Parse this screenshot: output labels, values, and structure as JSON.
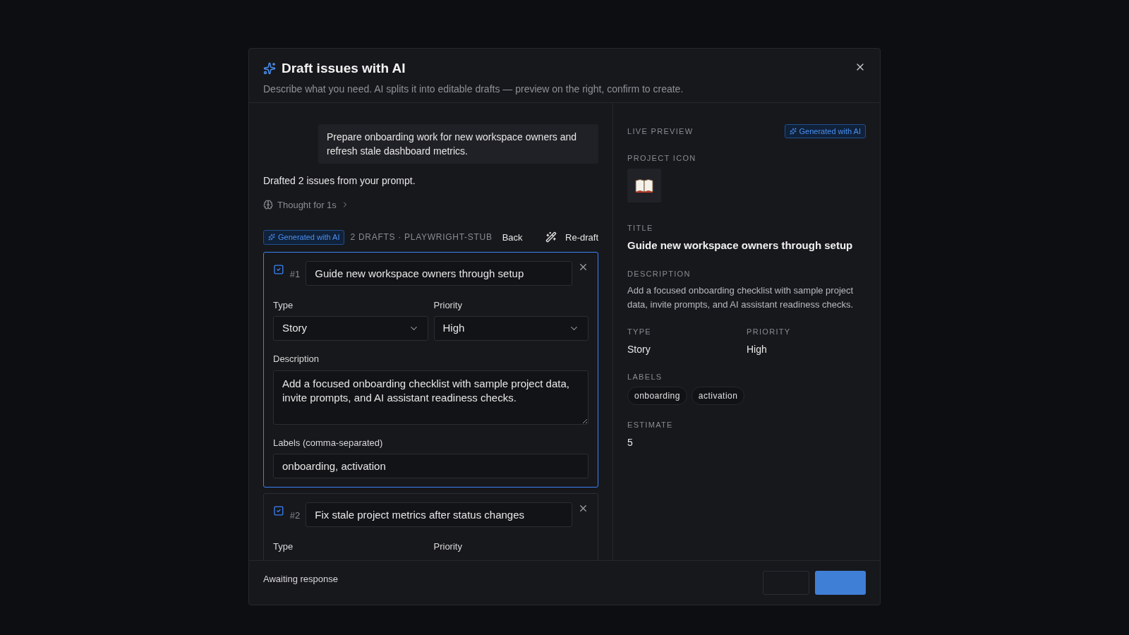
{
  "dialog": {
    "title": "Draft issues with AI",
    "subtitle": "Describe what you need. AI splits it into editable drafts — preview on the right, confirm to create."
  },
  "prompt": "Prepare onboarding work for new workspace owners and refresh stale dashboard metrics.",
  "response": "Drafted 2 issues from your prompt.",
  "thought": {
    "label": "Thought for 1s",
    "expanded": false
  },
  "toolbar": {
    "badge": "Generated with AI",
    "meta": "2 DRAFTS · PLAYWRIGHT-STUB",
    "back": "Back",
    "redraft": "Re-draft"
  },
  "drafts": [
    {
      "number": "#1",
      "checked": true,
      "selected": true,
      "title": "Guide new workspace owners through setup",
      "type_label": "Type",
      "type": "Story",
      "priority_label": "Priority",
      "priority": "High",
      "description_label": "Description",
      "description": "Add a focused onboarding checklist with sample project data, invite prompts, and AI assistant readiness checks.",
      "labels_label": "Labels (comma-separated)",
      "labels": "onboarding, activation"
    },
    {
      "number": "#2",
      "checked": true,
      "selected": false,
      "title": "Fix stale project metrics after status changes",
      "type_label": "Type",
      "priority_label": "Priority"
    }
  ],
  "preview": {
    "heading": "LIVE PREVIEW",
    "badge": "Generated with AI",
    "icon_label": "PROJECT ICON",
    "title_label": "TITLE",
    "title": "Guide new workspace owners through setup",
    "description_label": "DESCRIPTION",
    "description": "Add a focused onboarding checklist with sample project data, invite prompts, and AI assistant readiness checks.",
    "type_label": "TYPE",
    "type": "Story",
    "priority_label": "PRIORITY",
    "priority": "High",
    "labels_label": "LABELS",
    "labels": [
      "onboarding",
      "activation"
    ],
    "estimate_label": "ESTIMATE",
    "estimate": "5"
  },
  "footer": {
    "status": "Awaiting response"
  }
}
